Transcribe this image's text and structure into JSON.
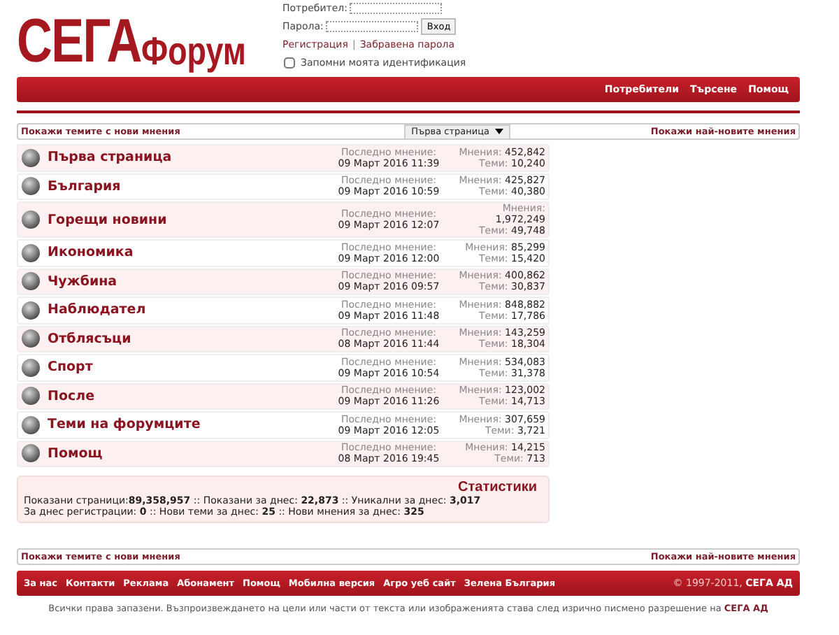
{
  "logo": {
    "main": "СЕГА",
    "sub": "Форум"
  },
  "login": {
    "user_label": "Потребител:",
    "pass_label": "Парола:",
    "submit": "Вход",
    "links": [
      "Регистрация",
      "Забравена парола"
    ],
    "separator": "|",
    "remember": {
      "label": "Запомни моята идентификация",
      "checked": false
    }
  },
  "nav": [
    "Потребители",
    "Търсене",
    "Помощ"
  ],
  "toolbar": {
    "left": "Покажи темите с нови мнения",
    "select": "Първа страница",
    "right": "Покажи най-новите мнения"
  },
  "forums": [
    {
      "title": "Първа страница",
      "last_label": "Последно мнение:",
      "last_date": "09 Март 2016 11:39",
      "posts_label": "Мнения:",
      "posts": "452,842",
      "topics_label": "Теми:",
      "topics": "10,240",
      "kind": "inline"
    },
    {
      "title": "България",
      "last_label": "Последно мнение:",
      "last_date": "09 Март 2016 10:59",
      "posts_label": "Мнения:",
      "posts": "425,827",
      "topics_label": "Теми:",
      "topics": "40,380",
      "kind": "inline"
    },
    {
      "title": "Горещи новини",
      "last_label": "Последно мнение:",
      "last_date": "09 Март 2016 12:07",
      "posts_label": "Мнения:",
      "posts": "1,972,249",
      "topics_label": "Теми:",
      "topics": "49,748",
      "kind": "wrapped"
    },
    {
      "title": "Икономика",
      "last_label": "Последно мнение:",
      "last_date": "09 Март 2016 12:00",
      "posts_label": "Мнения:",
      "posts": "85,299",
      "topics_label": "Теми:",
      "topics": "15,420",
      "kind": "inline"
    },
    {
      "title": "Чужбина",
      "last_label": "Последно мнение:",
      "last_date": "09 Март 2016 09:57",
      "posts_label": "Мнения:",
      "posts": "400,862",
      "topics_label": "Теми:",
      "topics": "30,837",
      "kind": "inline"
    },
    {
      "title": "Наблюдател",
      "last_label": "Последно мнение:",
      "last_date": "09 Март 2016 11:48",
      "posts_label": "Мнения:",
      "posts": "848,882",
      "topics_label": "Теми:",
      "topics": "17,786",
      "kind": "inline"
    },
    {
      "title": "Отблясъци",
      "last_label": "Последно мнение:",
      "last_date": "08 Март 2016 11:44",
      "posts_label": "Мнения:",
      "posts": "143,259",
      "topics_label": "Теми:",
      "topics": "18,304",
      "kind": "inline"
    },
    {
      "title": "Спорт",
      "last_label": "Последно мнение:",
      "last_date": "09 Март 2016 10:54",
      "posts_label": "Мнения:",
      "posts": "534,083",
      "topics_label": "Теми:",
      "topics": "31,378",
      "kind": "inline"
    },
    {
      "title": "После",
      "last_label": "Последно мнение:",
      "last_date": "09 Март 2016 11:26",
      "posts_label": "Мнения:",
      "posts": "123,002",
      "topics_label": "Теми:",
      "topics": "14,713",
      "kind": "inline"
    },
    {
      "title": "Теми на форумците",
      "last_label": "Последно мнение:",
      "last_date": "09 Март 2016 12:05",
      "posts_label": "Мнения:",
      "posts": "307,659",
      "topics_label": "Теми:",
      "topics": "3,721",
      "kind": "inline"
    },
    {
      "title": "Помощ",
      "last_label": "Последно мнение:",
      "last_date": "08 Март 2016 19:45",
      "posts_label": "Мнения:",
      "posts": "14,215",
      "topics_label": "Теми:",
      "topics": "713",
      "kind": "inline"
    }
  ],
  "stats": {
    "title": "Статистики",
    "lines": [
      "Показани страници:**89,358,957** :: Показани за днес: **22,873** :: Уникални за днес: **3,017**",
      "За днес регистрации: **0** :: Нови теми за днес: **25** :: Нови мнения за днес: **325**"
    ]
  },
  "bottom_toolbar": {
    "left": "Покажи темите с нови мнения",
    "right": "Покажи най-новите мнения"
  },
  "footer": {
    "links": [
      "За нас",
      "Контакти",
      "Реклама",
      "Абонамент",
      "Помощ",
      "Мобилна версия",
      "Агро уеб сайт",
      "Зелена България"
    ],
    "copyright": "© 1997-2011, **СЕГА АД**"
  },
  "legal": "Всички права запазени. Възпроизвеждането на цели или части от текста или изображенията става след изрично писмено разрешение на **СЕГА АД**"
}
